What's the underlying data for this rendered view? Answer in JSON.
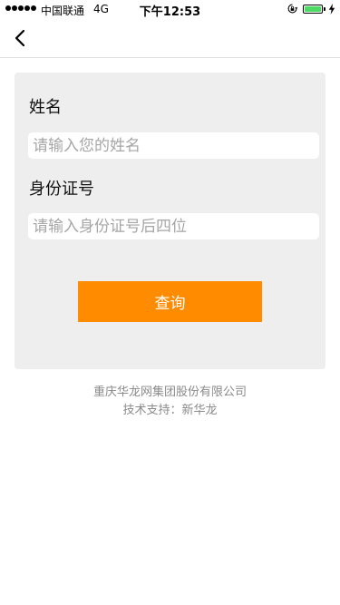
{
  "status_bar": {
    "carrier": "中国联通",
    "network": "4G",
    "time": "下午12:53",
    "battery_level": 1.0,
    "battery_color": "#4cd964"
  },
  "nav": {
    "back_icon": "chevron-left-icon"
  },
  "form": {
    "name_label": "姓名",
    "name_placeholder": "请输入您的姓名",
    "name_value": "",
    "id_label": "身份证号",
    "id_placeholder": "请输入身份证号后四位",
    "id_value": "",
    "submit_label": "查询",
    "submit_color": "#ff8c00"
  },
  "footer": {
    "company": "重庆华龙网集团股份有限公司",
    "support": "技术支持：新华龙"
  }
}
